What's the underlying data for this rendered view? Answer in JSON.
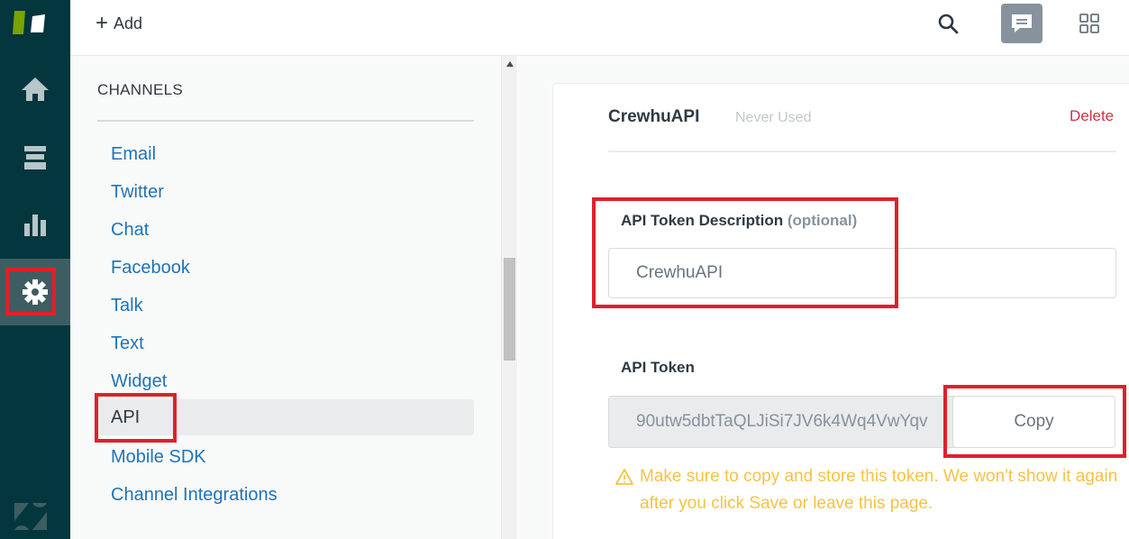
{
  "topbar": {
    "add_label": "Add"
  },
  "channels": {
    "heading": "CHANNELS",
    "items": [
      {
        "label": "Email"
      },
      {
        "label": "Twitter"
      },
      {
        "label": "Chat"
      },
      {
        "label": "Facebook"
      },
      {
        "label": "Talk"
      },
      {
        "label": "Text"
      },
      {
        "label": "Widget"
      },
      {
        "label": "API"
      },
      {
        "label": "Mobile SDK"
      },
      {
        "label": "Channel Integrations"
      }
    ],
    "selected": "API"
  },
  "token": {
    "name": "CrewhuAPI",
    "status": "Never Used",
    "delete_label": "Delete",
    "description_label": "API Token Description",
    "description_optional": "(optional)",
    "description_value": "CrewhuAPI",
    "token_label": "API Token",
    "token_value": "90utw5dbtTaQLJiSi7JV6k4Wq4VwYqv",
    "copy_label": "Copy",
    "warning_text": "Make sure to copy and store this token. We won't show it again after you click Save or leave this page."
  },
  "colors": {
    "rail": "#03363d",
    "link": "#1f73b7",
    "danger": "#cc3340",
    "warning": "#f5c245",
    "highlight_box": "#e0202a"
  }
}
